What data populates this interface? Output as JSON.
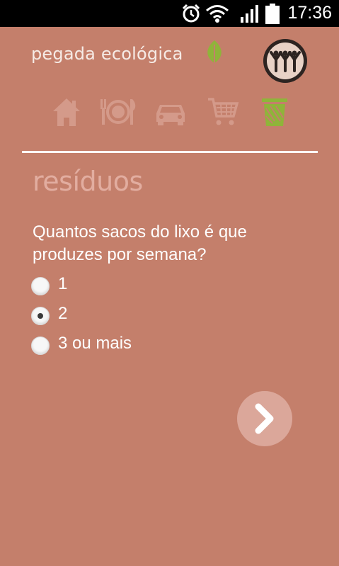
{
  "status_bar": {
    "time": "17:36",
    "icons": [
      "alarm-icon",
      "wifi-icon",
      "signal-icon",
      "battery-icon"
    ]
  },
  "app": {
    "brand": "pegada ecológica",
    "categories": [
      {
        "name": "home",
        "icon": "house-icon",
        "active": false
      },
      {
        "name": "food",
        "icon": "plate-cutlery-icon",
        "active": false
      },
      {
        "name": "transport",
        "icon": "car-icon",
        "active": false
      },
      {
        "name": "shopping",
        "icon": "shopping-cart-icon",
        "active": false
      },
      {
        "name": "waste",
        "icon": "trash-bin-icon",
        "active": true
      }
    ],
    "colors": {
      "background": "#c47f6b",
      "inactive_icon": "#d49a8a",
      "active_icon": "#8fb43a",
      "section_title": "#e2ada0"
    }
  },
  "section": {
    "title": "resíduos",
    "question": "Quantos sacos do lixo é que produzes por semana?",
    "options": [
      {
        "label": "1",
        "selected": false
      },
      {
        "label": "2",
        "selected": true
      },
      {
        "label": "3 ou mais",
        "selected": false
      }
    ]
  },
  "next_button": {
    "icon": "chevron-right-icon"
  }
}
